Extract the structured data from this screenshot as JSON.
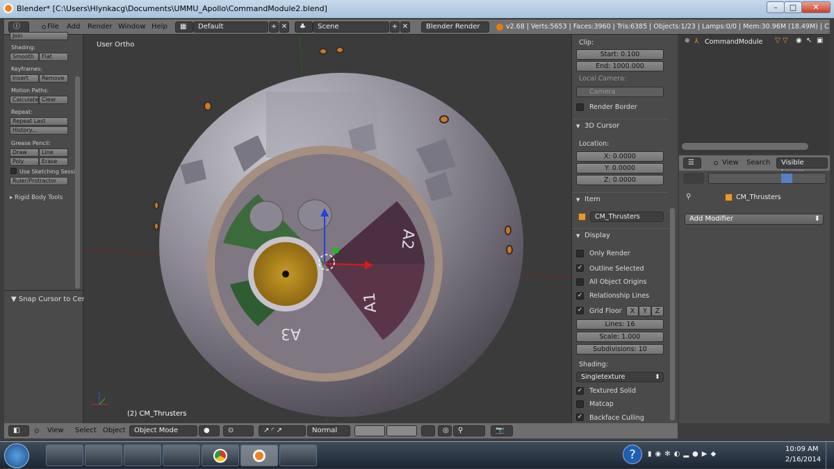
{
  "window": {
    "title": "Blender* [C:\\Users\\Hlynkacg\\Documents\\UMMU_Apollo\\CommandModule2.blend]",
    "minimize": "–",
    "maximize": "□",
    "close": "✕"
  },
  "info": {
    "menus": [
      "File",
      "Add",
      "Render",
      "Window",
      "Help"
    ],
    "layout": "Default",
    "scene": "Scene",
    "engine": "Blender Render",
    "stats": "v2.68 | Verts:5653 | Faces:3960 | Tris:6385 | Objects:1/23 | Lamps:0/0 | Mem:30.96M (18.49M) | C"
  },
  "shelf": {
    "join": "Join",
    "shading_label": "Shading:",
    "smooth": "Smooth",
    "flat": "Flat",
    "keyframes_label": "Keyframes:",
    "insert": "Insert",
    "remove": "Remove",
    "motion_label": "Motion Paths:",
    "calculate": "Calculate",
    "clear": "Clear",
    "repeat_label": "Repeat:",
    "repeat_last": "Repeat Last",
    "history": "History...",
    "grease_label": "Grease Pencil:",
    "draw": "Draw",
    "line": "Line",
    "poly": "Poly",
    "erase": "Erase",
    "sketching": "Use Sketching Sessi",
    "ruler": "Ruler/Protractor",
    "rigid": "Rigid Body Tools",
    "snap": "Snap Cursor to Cen"
  },
  "viewport": {
    "view_label": "User Ortho",
    "object_label": "(2) CM_Thrusters",
    "quad_labels": [
      "A1",
      "A2",
      "A3"
    ]
  },
  "npanel": {
    "clip_label": "Clip:",
    "start": "Start: 0.100",
    "end": "End: 1000.000",
    "local_camera": "Local Camera:",
    "camera": "Camera",
    "render_border": "Render Border",
    "cursor_header": "3D Cursor",
    "location": "Location:",
    "x": "X: 0.0000",
    "y": "Y: 0.0000",
    "z": "Z: 0.0000",
    "item_header": "Item",
    "item_name": "CM_Thrusters",
    "display_header": "Display",
    "only_render": "Only Render",
    "outline_selected": "Outline Selected",
    "all_origins": "All Object Origins",
    "relationship": "Relationship Lines",
    "grid_floor": "Grid Floor",
    "gx": "X",
    "gy": "Y",
    "gz": "Z",
    "lines": "Lines: 16",
    "scale": "Scale: 1.000",
    "subdivisions": "Subdivisions: 10",
    "shading_label": "Shading:",
    "shading_value": "Singletexture",
    "textured_solid": "Textured Solid",
    "matcap": "Matcap",
    "backface": "Backface Culling"
  },
  "outliner": {
    "item": "CommandModule"
  },
  "properties": {
    "view": "View",
    "search": "Search",
    "visible_layers": "Visible Layers",
    "object": "CM_Thrusters",
    "add_modifier": "Add Modifier"
  },
  "vheader": {
    "view": "View",
    "select": "Select",
    "object": "Object",
    "mode": "Object Mode",
    "pivot": "Normal"
  },
  "taskbar": {
    "time": "10:09 AM",
    "date": "2/16/2014"
  }
}
